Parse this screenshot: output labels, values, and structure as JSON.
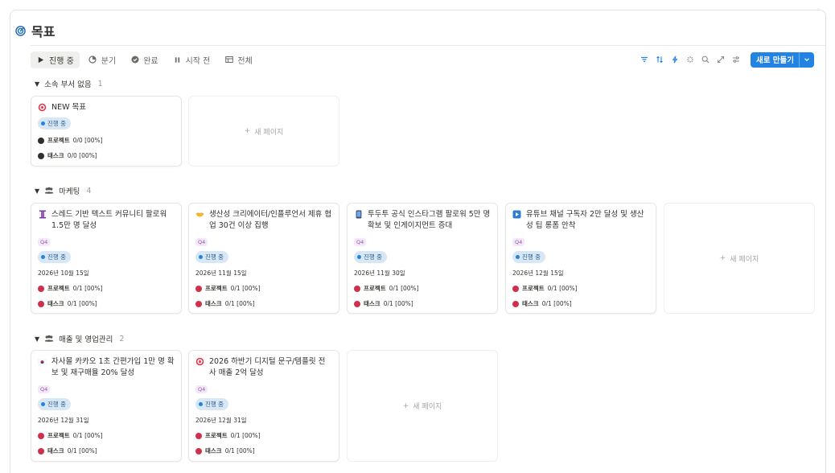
{
  "page": {
    "title": "목표",
    "title_icon": "target-icon"
  },
  "tabs": [
    {
      "label": "진행 중",
      "icon": "play-icon",
      "active": true
    },
    {
      "label": "분기",
      "icon": "pie-icon",
      "active": false
    },
    {
      "label": "완료",
      "icon": "check-circle-icon",
      "active": false
    },
    {
      "label": "시작 전",
      "icon": "pause-icon",
      "active": false
    },
    {
      "label": "전체",
      "icon": "table-icon",
      "active": false
    }
  ],
  "toolbar": {
    "new_label": "새로 만들기",
    "accent": "#2383e2"
  },
  "new_page_label": "새 페이지",
  "groups": [
    {
      "name": "소속 부서 없음",
      "count": "1",
      "icon": "",
      "cards": [
        {
          "title": "NEW 목표",
          "emoji": "target-icon",
          "tag": "",
          "status": "진행 중",
          "date": "",
          "project_label": "프로젝트",
          "project_value": "0/0 [00%]",
          "task_label": "태스크",
          "task_value": "0/0 [00%]",
          "dot_color": "#2f2f2f"
        }
      ]
    },
    {
      "name": "마케팅",
      "count": "4",
      "icon": "people-icon",
      "cards": [
        {
          "title": "스레드 기반 텍스트 커뮤니티 팔로워 1.5만 명 달성",
          "emoji": "thread-icon",
          "tag": "Q4",
          "status": "진행 중",
          "date": "2026년 10월 15일",
          "project_label": "프로젝트",
          "project_value": "0/1 [00%]",
          "task_label": "태스크",
          "task_value": "0/1 [00%]",
          "dot_color": "#d0304b"
        },
        {
          "title": "생산성 크리에이터/인플루언서 제휴 협업 30건 이상 집행",
          "emoji": "handshake-icon",
          "tag": "Q4",
          "status": "진행 중",
          "date": "2026년 11월 15일",
          "project_label": "프로젝트",
          "project_value": "0/1 [00%]",
          "task_label": "태스크",
          "task_value": "0/1 [00%]",
          "dot_color": "#d0304b"
        },
        {
          "title": "투두투 공식 인스타그램 팔로워 5만 명 확보 및 인게이지먼트 증대",
          "emoji": "phone-icon",
          "tag": "Q4",
          "status": "진행 중",
          "date": "2026년 11월 30일",
          "project_label": "프로젝트",
          "project_value": "0/1 [00%]",
          "task_label": "태스크",
          "task_value": "0/1 [00%]",
          "dot_color": "#d0304b"
        },
        {
          "title": "유튜브 채널 구독자 2만 달성 및 생산성 팁 롱폼 안착",
          "emoji": "play-button-icon",
          "tag": "Q4",
          "status": "진행 중",
          "date": "2026년 12월 15일",
          "project_label": "프로젝트",
          "project_value": "0/1 [00%]",
          "task_label": "태스크",
          "task_value": "0/1 [00%]",
          "dot_color": "#d0304b"
        }
      ]
    },
    {
      "name": "매출 및 영업관리",
      "count": "2",
      "icon": "people-icon",
      "cards": [
        {
          "title": "자사몰 카카오 1초 간편가입 1만 명 확보 및 재구매율 20% 달성",
          "emoji": "flag-kr-icon",
          "tag": "Q4",
          "status": "진행 중",
          "date": "2026년 12월 31일",
          "project_label": "프로젝트",
          "project_value": "0/1 [00%]",
          "task_label": "태스크",
          "task_value": "0/1 [00%]",
          "dot_color": "#d0304b"
        },
        {
          "title": "2026 하반기 디지털 문구/템플릿 전사 매출 2억 달성",
          "emoji": "target-icon",
          "tag": "Q4",
          "status": "진행 중",
          "date": "2026년 12월 31일",
          "project_label": "프로젝트",
          "project_value": "0/1 [00%]",
          "task_label": "태스크",
          "task_value": "0/1 [00%]",
          "dot_color": "#d0304b"
        }
      ]
    }
  ]
}
